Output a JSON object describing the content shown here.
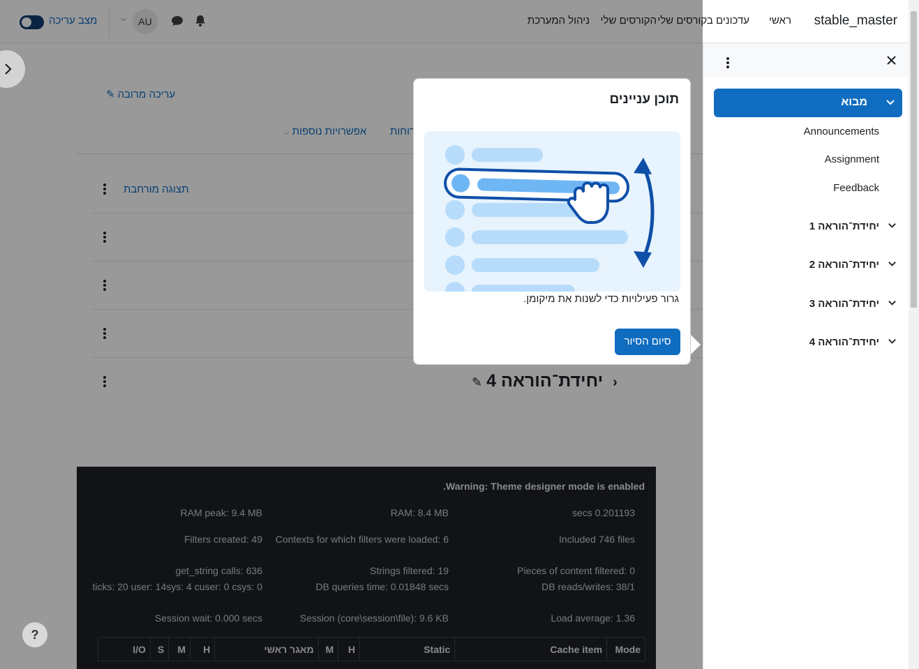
{
  "navbar": {
    "brand": "stable_master",
    "nav_home": "ראשי",
    "nav_updates": "עדכונים בקורסים שלי",
    "nav_my_courses": "הקורסים שלי",
    "nav_site_admin": "ניהול המערכת",
    "edit_mode_label": "מצב עריכה",
    "avatar_initials": "AU"
  },
  "main": {
    "bulk_edit": "עריכה מרובה",
    "more_options": "אפשרויות נוספות",
    "tab_partial": "רוחות",
    "expanded_view": "תצוגה מורחבת",
    "section4_title": "יחידת־הוראה 4"
  },
  "perf": {
    "warning": "Warning: Theme designer mode is enabled.",
    "secs": "secs 0.201193",
    "ram": "RAM: 8.4 MB",
    "ram_peak": "RAM peak: 9.4 MB",
    "included": "Included 746 files",
    "contexts": "Contexts for which filters were loaded: 6",
    "filters_created": "Filters created: 49",
    "pieces": "Pieces of content filtered: 0",
    "strings": "Strings filtered: 19",
    "get_string": "get_string calls: 636",
    "db_rw": "DB reads/writes: 38/1",
    "db_time": "DB queries time: 0.01848 secs",
    "ticks": "ticks: 20 user: 14sys: 4 cuser: 0 csys: 0",
    "load": "Load average: 1.36",
    "session": "Session (core\\session\\file): 9.6 KB",
    "session_wait": "Session wait: 0.000 secs",
    "table_headers": [
      "Mode",
      "Cache item",
      "Static",
      "H",
      "M",
      "מאגר ראשי",
      "H",
      "M",
      "S",
      "I/O"
    ]
  },
  "drawer": {
    "active_section": "מבוא",
    "activities": [
      "Announcements",
      "Assignment",
      "Feedback"
    ],
    "sections": [
      "יחידת־הוראה 1",
      "יחידת־הוראה 2",
      "יחידת־הוראה 3",
      "יחידת־הוראה 4"
    ]
  },
  "tour": {
    "title": "תוכן עניינים",
    "text": "גרור פעילויות כדי לשנות את מיקומן.",
    "button": "סיום הסיור"
  },
  "help": {
    "label": "?"
  },
  "colors": {
    "brand_blue": "#0f6cbf",
    "dark_footer": "#1d2125",
    "edit_switch": "#0f3c6e"
  }
}
